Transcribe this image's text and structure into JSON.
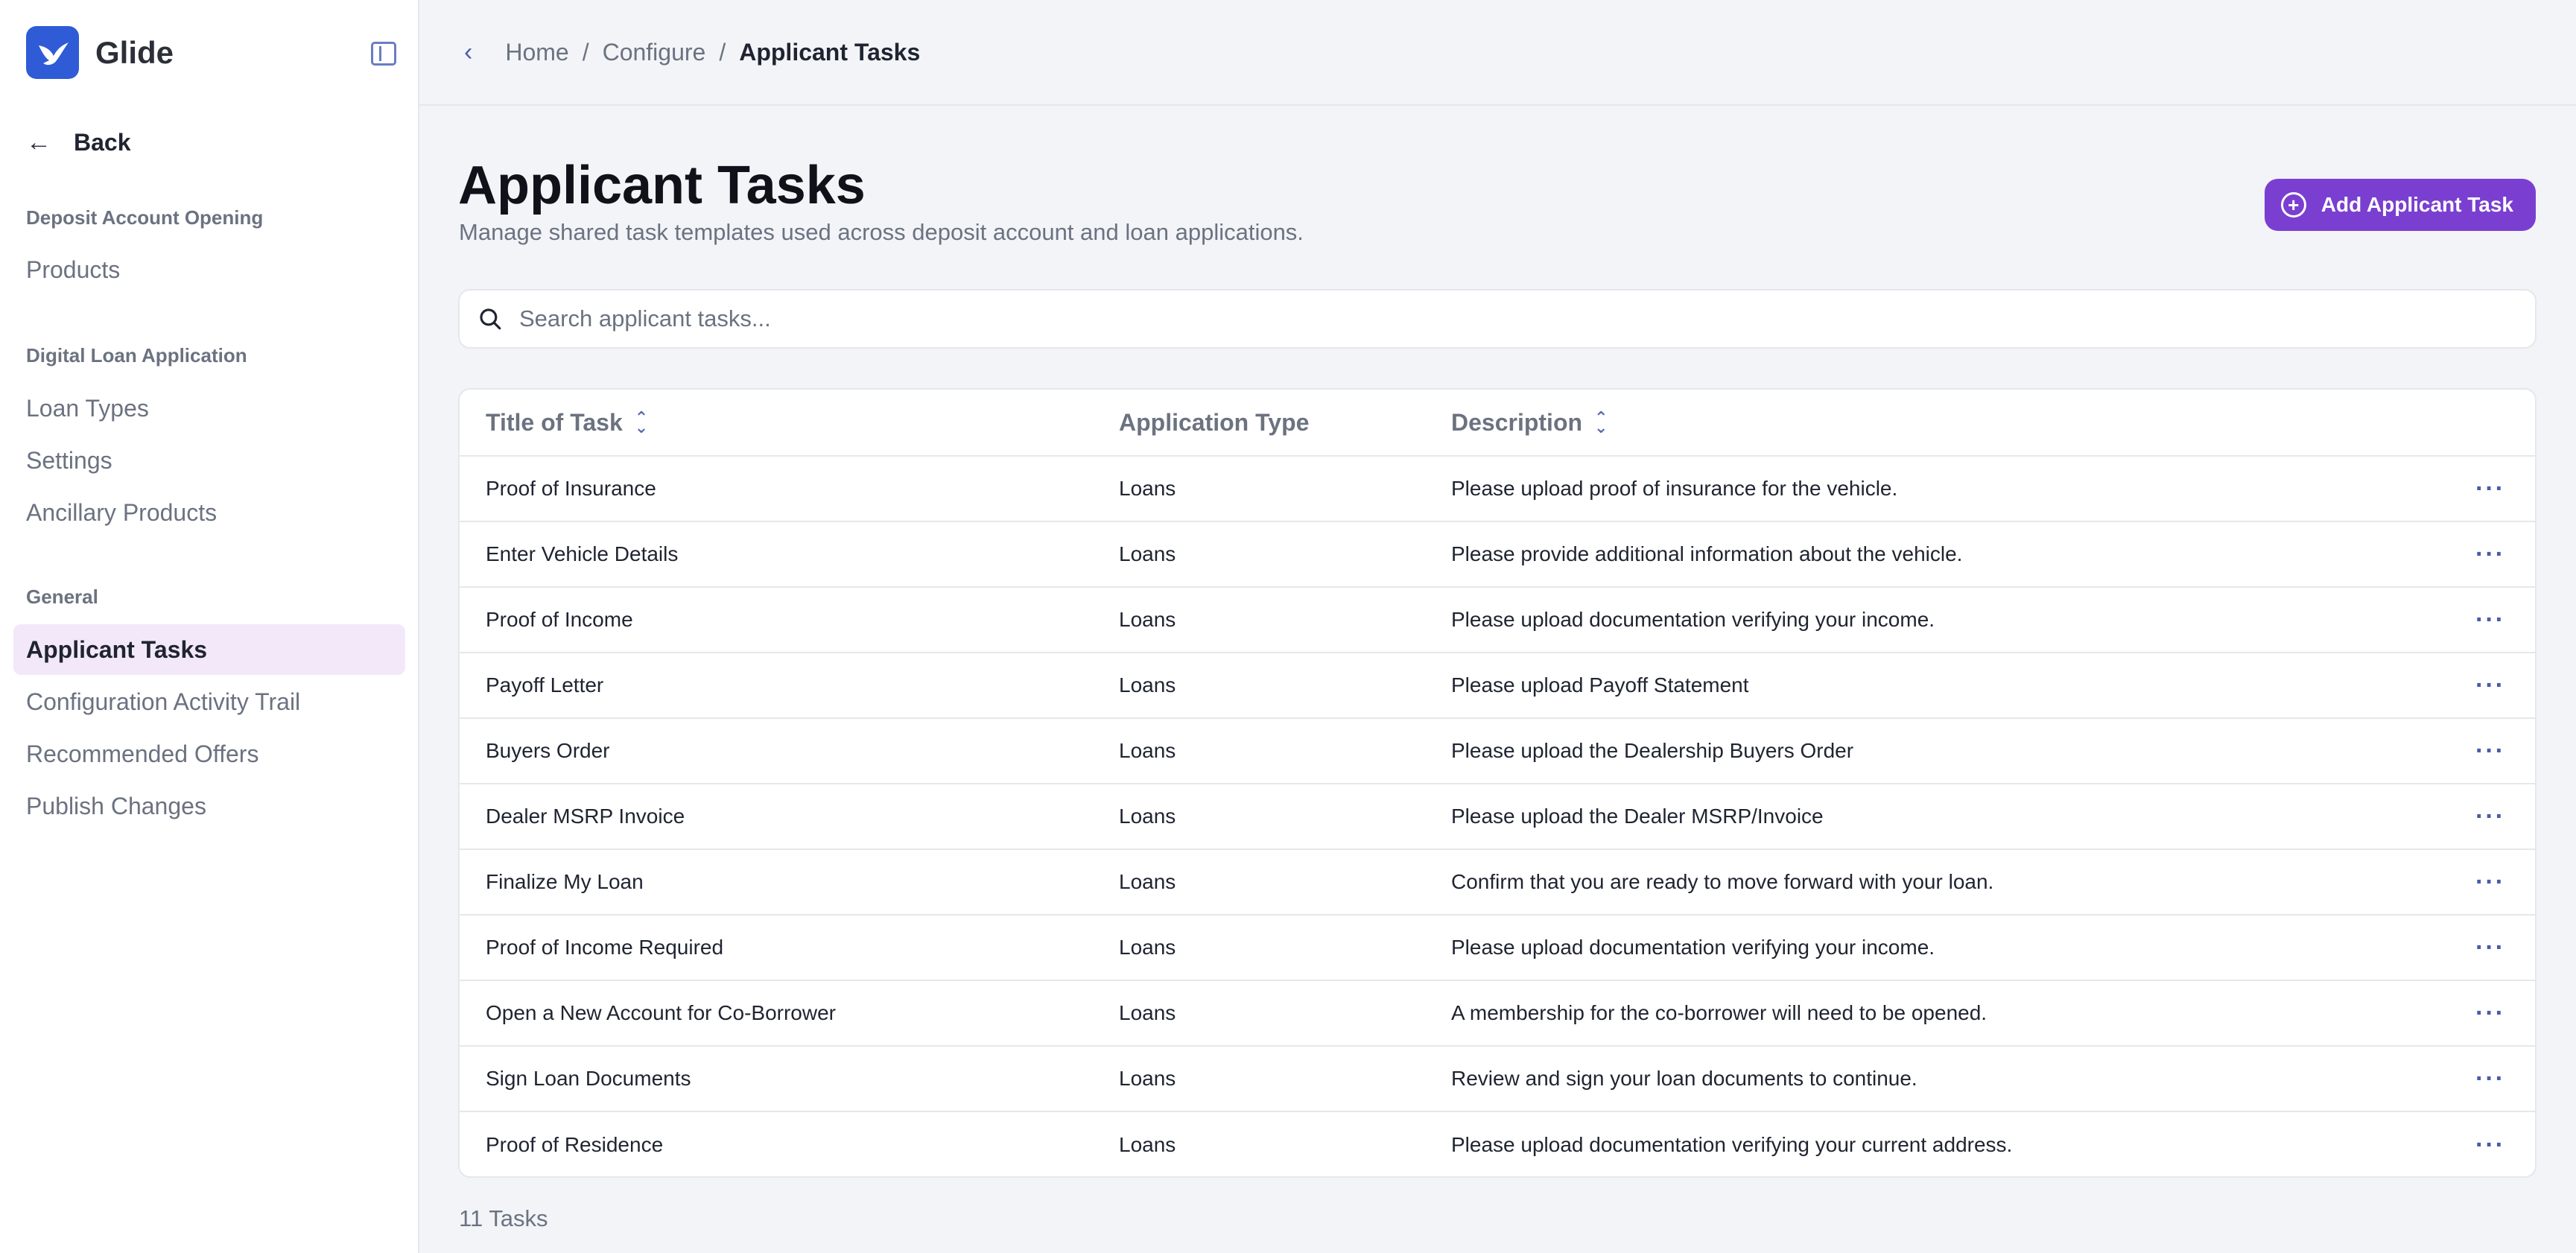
{
  "app": {
    "name": "Glide"
  },
  "sidebar": {
    "back_label": "Back",
    "sections": [
      {
        "label": "Deposit Account Opening",
        "items": [
          "Products"
        ]
      },
      {
        "label": "Digital Loan Application",
        "items": [
          "Loan Types",
          "Settings",
          "Ancillary Products"
        ]
      },
      {
        "label": "General",
        "items": [
          "Applicant Tasks",
          "Configuration Activity Trail",
          "Recommended Offers",
          "Publish Changes"
        ]
      }
    ],
    "active_item": "Applicant Tasks"
  },
  "breadcrumb": [
    "Home",
    "Configure",
    "Applicant Tasks"
  ],
  "page": {
    "title": "Applicant Tasks",
    "subtitle": "Manage shared task templates used across deposit account and loan applications.",
    "add_button": "Add Applicant Task",
    "search_placeholder": "Search applicant tasks..."
  },
  "table": {
    "columns": [
      "Title of Task",
      "Application Type",
      "Description"
    ],
    "rows": [
      {
        "title": "Proof of Insurance",
        "type": "Loans",
        "description": "Please upload proof of insurance for the vehicle."
      },
      {
        "title": "Enter Vehicle Details",
        "type": "Loans",
        "description": "Please provide additional information about the vehicle."
      },
      {
        "title": "Proof of Income",
        "type": "Loans",
        "description": "Please upload documentation verifying your income."
      },
      {
        "title": "Payoff Letter",
        "type": "Loans",
        "description": "Please upload Payoff Statement"
      },
      {
        "title": "Buyers Order",
        "type": "Loans",
        "description": "Please upload the Dealership Buyers Order"
      },
      {
        "title": "Dealer MSRP Invoice",
        "type": "Loans",
        "description": "Please upload the Dealer MSRP/Invoice"
      },
      {
        "title": "Finalize My Loan",
        "type": "Loans",
        "description": "Confirm that you are ready to move forward with your loan."
      },
      {
        "title": "Proof of Income Required",
        "type": "Loans",
        "description": "Please upload documentation verifying your income."
      },
      {
        "title": "Open a New Account for Co-Borrower",
        "type": "Loans",
        "description": "A membership for the co-borrower will need to be opened."
      },
      {
        "title": "Sign Loan Documents",
        "type": "Loans",
        "description": "Review and sign your loan documents to continue."
      },
      {
        "title": "Proof of Residence",
        "type": "Loans",
        "description": "Please upload documentation verifying your current address."
      }
    ],
    "footer": "11 Tasks"
  },
  "colors": {
    "accent": "#7a3fd0",
    "logo": "#2f5bd6",
    "active_bg": "#f3e8fa",
    "link": "#4c5ba8"
  },
  "icons": [
    "bird-logo-icon",
    "sidebar-toggle-icon",
    "arrow-left-icon",
    "chevron-left-icon",
    "plus-circle-icon",
    "search-icon",
    "sort-icon",
    "more-horizontal-icon"
  ]
}
